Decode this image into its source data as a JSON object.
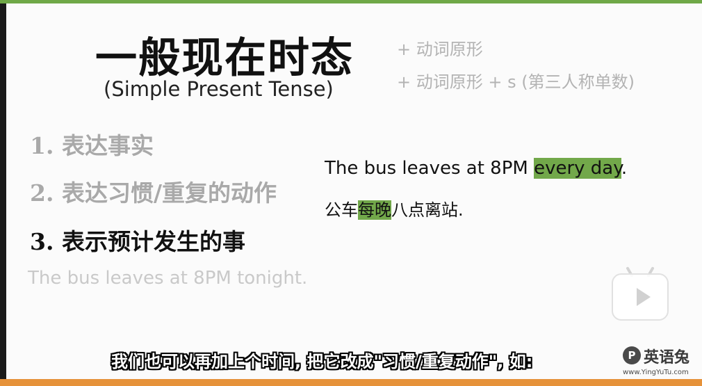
{
  "slide": {
    "title": "一般现在时态",
    "subtitle": "(Simple Present Tense)",
    "rules": [
      "+ 动词原形",
      "+ 动词原形 + s (第三人称单数)"
    ],
    "points": [
      "1. 表达事实",
      "2. 表达习惯/重复的动作",
      "3. 表示预计发生的事"
    ],
    "faded_example": "The bus leaves at 8PM tonight.",
    "example": {
      "en_before": "The bus leaves at 8PM ",
      "en_highlight": "every day",
      "en_after": ".",
      "zh_before": "公车",
      "zh_highlight": "每晚",
      "zh_after": "八点离站."
    }
  },
  "caption": "我们也可以再加上个时间, 把它改成\"习惯/重复动作\", 如:",
  "watermark": {
    "mark": "P",
    "name": "英语兔",
    "url": "www.YingYuTu.com"
  },
  "colors": {
    "top_bar": "#6fa847",
    "bottom_bar": "#e6923a",
    "highlight": "#72a84a",
    "faded_text": "#a9a9a9"
  }
}
